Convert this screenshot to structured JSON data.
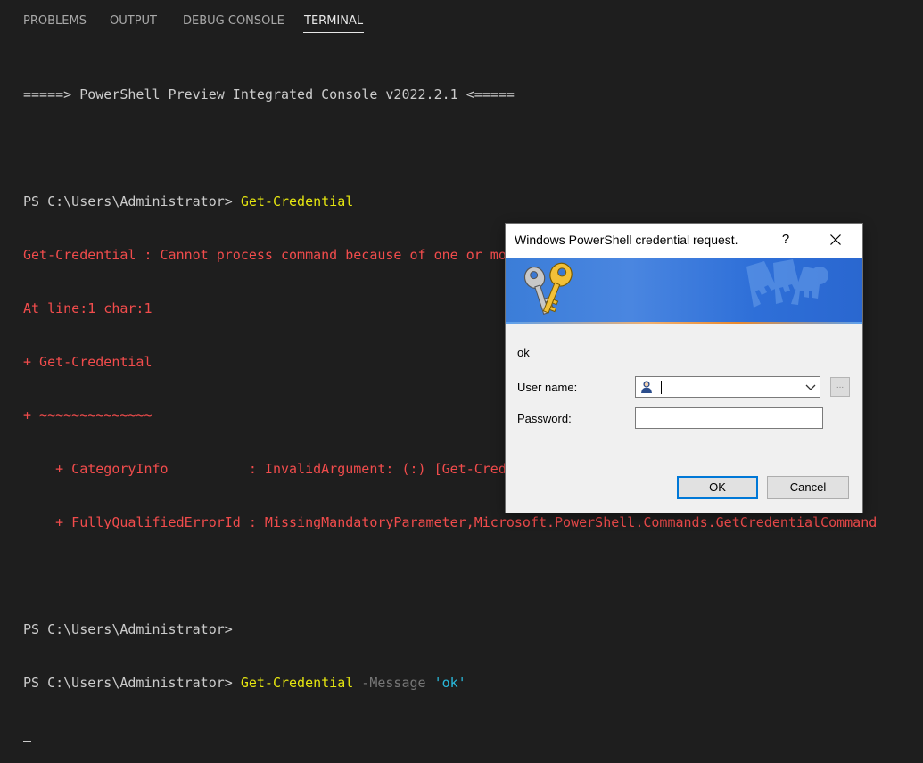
{
  "tabs": [
    {
      "label": "PROBLEMS"
    },
    {
      "label": "OUTPUT"
    },
    {
      "label": "DEBUG CONSOLE"
    },
    {
      "label": "TERMINAL",
      "active": true
    }
  ],
  "terminal": {
    "banner": "=====> PowerShell Preview Integrated Console v2022.2.1 <=====",
    "prompt1": "PS C:\\Users\\Administrator> ",
    "command1": "Get-Credential",
    "errors": [
      "Get-Credential : Cannot process command because of one or more missing mandatory parameters: Credential.",
      "At line:1 char:1",
      "+ Get-Credential",
      "+ ~~~~~~~~~~~~~~",
      "    + CategoryInfo          : InvalidArgument: (:) [Get-Credential], ParameterBindingException",
      "    + FullyQualifiedErrorId : MissingMandatoryParameter,Microsoft.PowerShell.Commands.GetCredentialCommand"
    ],
    "prompt2": "PS C:\\Users\\Administrator>",
    "prompt3": "PS C:\\Users\\Administrator> ",
    "command3": "Get-Credential",
    "param3": " -Message ",
    "arg3": "'ok'",
    "colors": {
      "background": "#1e1e1e",
      "text": "#cccccc",
      "command": "#e5e510",
      "error": "#f14c4c",
      "parameter": "#767676",
      "string": "#29b8db"
    }
  },
  "dialog": {
    "title": "Windows PowerShell credential request.",
    "help_label": "?",
    "close_icon": "close-icon",
    "message": "ok",
    "username_label": "User name:",
    "username_value": "",
    "browse_label": "...",
    "password_label": "Password:",
    "password_value": "",
    "ok_label": "OK",
    "cancel_label": "Cancel",
    "accent_color": "#0078d7"
  }
}
